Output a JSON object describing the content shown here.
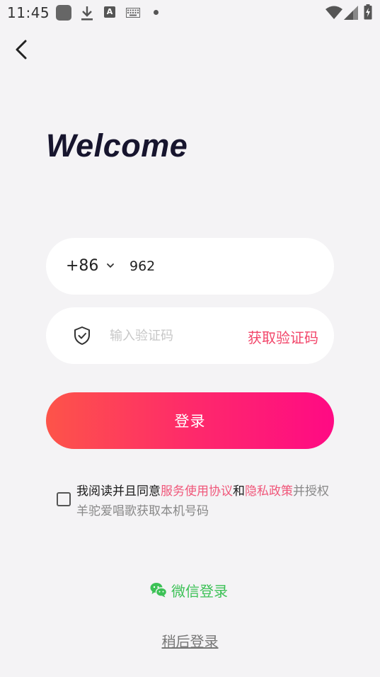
{
  "status_bar": {
    "time": "11:45",
    "a_glyph": "A",
    "icons": [
      "app-notification-icon",
      "download-icon",
      "a-icon",
      "keyboard-icon",
      "dot-icon",
      "wifi-icon",
      "signal-icon",
      "battery-charging-icon"
    ]
  },
  "nav": {
    "back_icon": "chevron-left-icon"
  },
  "welcome": "Welcome",
  "phone": {
    "country_code": "+86",
    "value": "962"
  },
  "code": {
    "placeholder": "输入验证码",
    "get_code_label": "获取验证码"
  },
  "login_label": "登录",
  "agreement": {
    "prefix": "我阅读并且同意",
    "terms": "服务使用协议",
    "and": "和",
    "privacy": "隐私政策",
    "suffix": "并授权羊驼爱唱歌获取本机号码"
  },
  "wechat_login": "微信登录",
  "later_login": "稍后登录",
  "colors": {
    "accent": "#f2466a",
    "gradient_start": "#fd5449",
    "gradient_end": "#ff0a84",
    "wechat": "#3cc156",
    "background": "#f4f3f5"
  }
}
